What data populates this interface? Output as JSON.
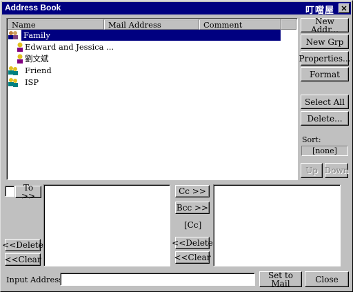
{
  "window": {
    "title": "Address Book",
    "brand_text": "叮噹屋",
    "close_label": "✕"
  },
  "list": {
    "columns": [
      "Name",
      "Mail Address",
      "Comment"
    ],
    "rows": [
      {
        "label": "Family",
        "icon": "group-icon",
        "indent": 0,
        "selected": true
      },
      {
        "label": "Edward and Jessica ...",
        "icon": "person-icon",
        "indent": 1,
        "selected": false
      },
      {
        "label": "劉文斌",
        "icon": "person-icon",
        "indent": 1,
        "selected": false
      },
      {
        "label": "Friend",
        "icon": "group-icon",
        "indent": 0,
        "selected": false
      },
      {
        "label": "ISP",
        "icon": "group-icon",
        "indent": 0,
        "selected": false
      }
    ]
  },
  "side_buttons": {
    "new_addr": "New Addr...",
    "new_grp": "New Grp",
    "properties": "Properties...",
    "format": "Format",
    "select_all": "Select All",
    "delete": "Delete...",
    "sort_label": "Sort:",
    "sort_value": "[none]",
    "up": "Up",
    "down": "Down"
  },
  "recipients": {
    "to_label": "To >>",
    "cc_label": "Cc >>",
    "bcc_label": "Bcc >>",
    "cc_indicator": "[Cc]",
    "left_delete": "<<Delete",
    "left_clear": "<<Clear",
    "right_delete": "<<Delete",
    "right_clear": "<<Clear"
  },
  "footer": {
    "input_label": "Input Address:",
    "input_value": "",
    "set_to_mail": "Set to Mail",
    "close": "Close"
  },
  "colors": {
    "face": "#c0c0c0",
    "title_bar": "#000080",
    "selection": "#000080"
  }
}
